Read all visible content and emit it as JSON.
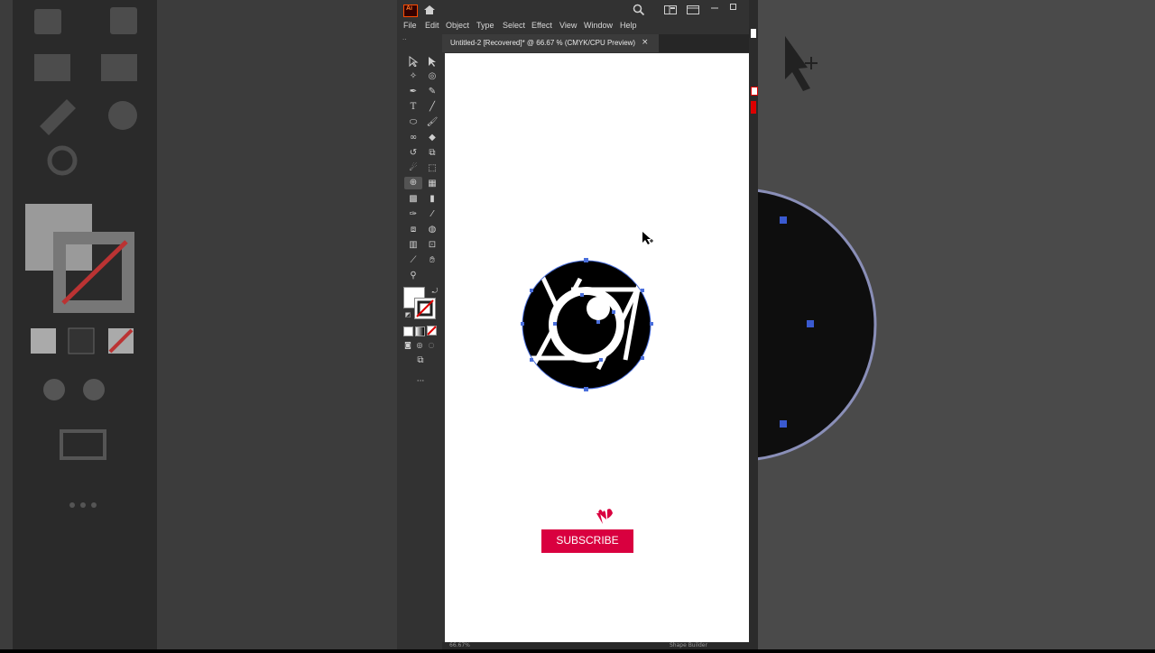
{
  "app": {
    "logo_text": "Ai",
    "menu": [
      "File",
      "Edit",
      "Object",
      "Type",
      "Select",
      "Effect",
      "View",
      "Window",
      "Help"
    ]
  },
  "document": {
    "tab_title": "Untitled-2 [Recovered]* @ 66.67 % (CMYK/CPU Preview)",
    "close_glyph": "×"
  },
  "overlay": {
    "subscribe_label": "SUBSCRIBE"
  },
  "status": {
    "zoom": "66.67%",
    "tool_name": "Shape Builder"
  },
  "colors": {
    "accent": "#d9003f",
    "selection": "#4a6fdc",
    "ui_dark": "#323232"
  }
}
